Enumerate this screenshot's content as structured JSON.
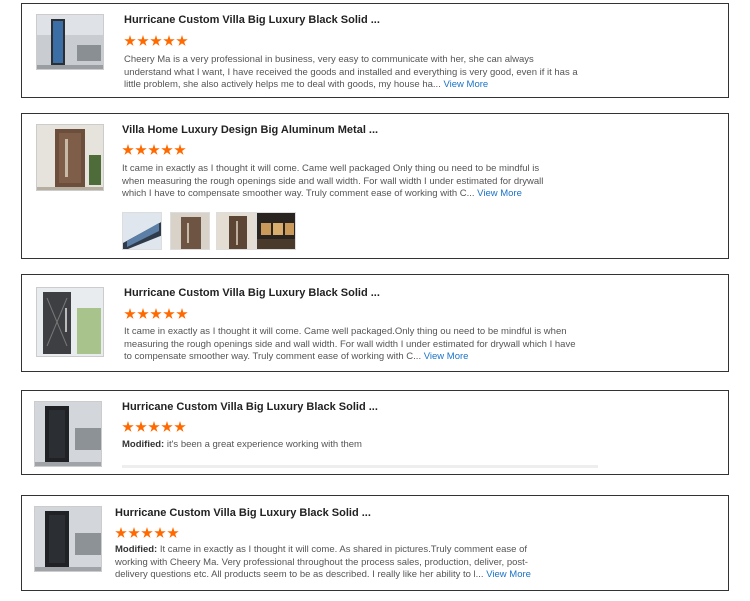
{
  "reviews": [
    {
      "title": "Hurricane Custom Villa Big Luxury Black Solid ...",
      "stars": 5,
      "modified_label": "",
      "text": "Cheery Ma is a very professional in business, very easy to communicate with her, she can always understand what I want, I have received the goods and installed and everything is very good, even if it has a little problem, she also actively helps me to deal with goods, my house ha...",
      "more": "View More",
      "photos": []
    },
    {
      "title": "Villa Home Luxury Design Big Aluminum Metal ...",
      "stars": 5,
      "modified_label": "",
      "text": "It came in exactly as I thought it will come.  Came well packaged Only thing ou need to be mindful is when measuring the rough openings side and wall width. For wall width I under estimated for drywall which I have to compensate smoother way.  Truly comment ease of working with C...",
      "more": "View More",
      "photos": [
        "photo-1",
        "photo-2",
        "photo-3",
        "photo-4"
      ]
    },
    {
      "title": "Hurricane Custom Villa Big Luxury Black Solid ...",
      "stars": 5,
      "modified_label": "",
      "text": "It came in exactly as I thought it will come.  Came well packaged.Only thing ou need to be mindful is when measuring the rough openings side and wall width. For wall width I under estimated for drywall which I have to compensate smoother way.  Truly comment ease of working with C...",
      "more": "View More",
      "photos": []
    },
    {
      "title": "Hurricane Custom Villa Big Luxury Black Solid ...",
      "stars": 5,
      "modified_label": "Modified:",
      "text": "it's been a great experience working with them",
      "more": "",
      "photos": []
    },
    {
      "title": "Hurricane Custom Villa Big Luxury Black Solid ...",
      "stars": 5,
      "modified_label": "Modified:",
      "text": "It came in exactly as I thought it will come. As shared in pictures.Truly comment ease of working with Cheery Ma. Very professional throughout the process sales, production, deliver, post-delivery questions etc. All products seem to be as described. I really like her ability to l...",
      "more": "View More",
      "photos": []
    }
  ],
  "colors": {
    "star": "#ff6a00",
    "link": "#1a73c8",
    "border": "#333333"
  }
}
